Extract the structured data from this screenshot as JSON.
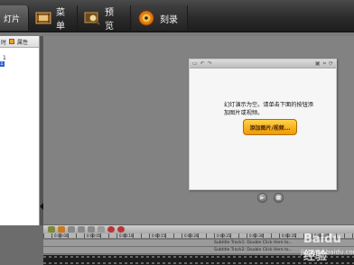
{
  "toolbar": {
    "active_tab_label": "灯片",
    "tabs": [
      {
        "label": "菜单",
        "icon": "film-menu-icon"
      },
      {
        "label": "预览",
        "icon": "magnifier-preview-icon"
      },
      {
        "label": "刻录",
        "icon": "disc-burn-icon"
      }
    ]
  },
  "left_panel": {
    "header_items": [
      "时",
      "属性"
    ],
    "tree": [
      "1",
      "1"
    ]
  },
  "preview": {
    "message": "幻灯演示为空。请单击下面的按钮添加图片或视频。",
    "add_button_label": "添加图片/视频..."
  },
  "timeline": {
    "ruler": [
      "0:00:00",
      "0:00:05",
      "0:00:10",
      "0:00:15",
      "0:00:20",
      "0:00:25",
      "0:00:30",
      "0:00:35",
      "0:00:40"
    ],
    "track1": "Subtitle Track1: Double Click Here to...",
    "track2": "Subtitle Track2: Double Click Here to..."
  },
  "watermark": {
    "logo": "Baidu 经验",
    "url": "jingyan.baidu.com"
  },
  "colors": {
    "accent_button": "#f5a800",
    "toolbar_bg": "#2b2b2b",
    "selection": "#2c5fd0"
  }
}
